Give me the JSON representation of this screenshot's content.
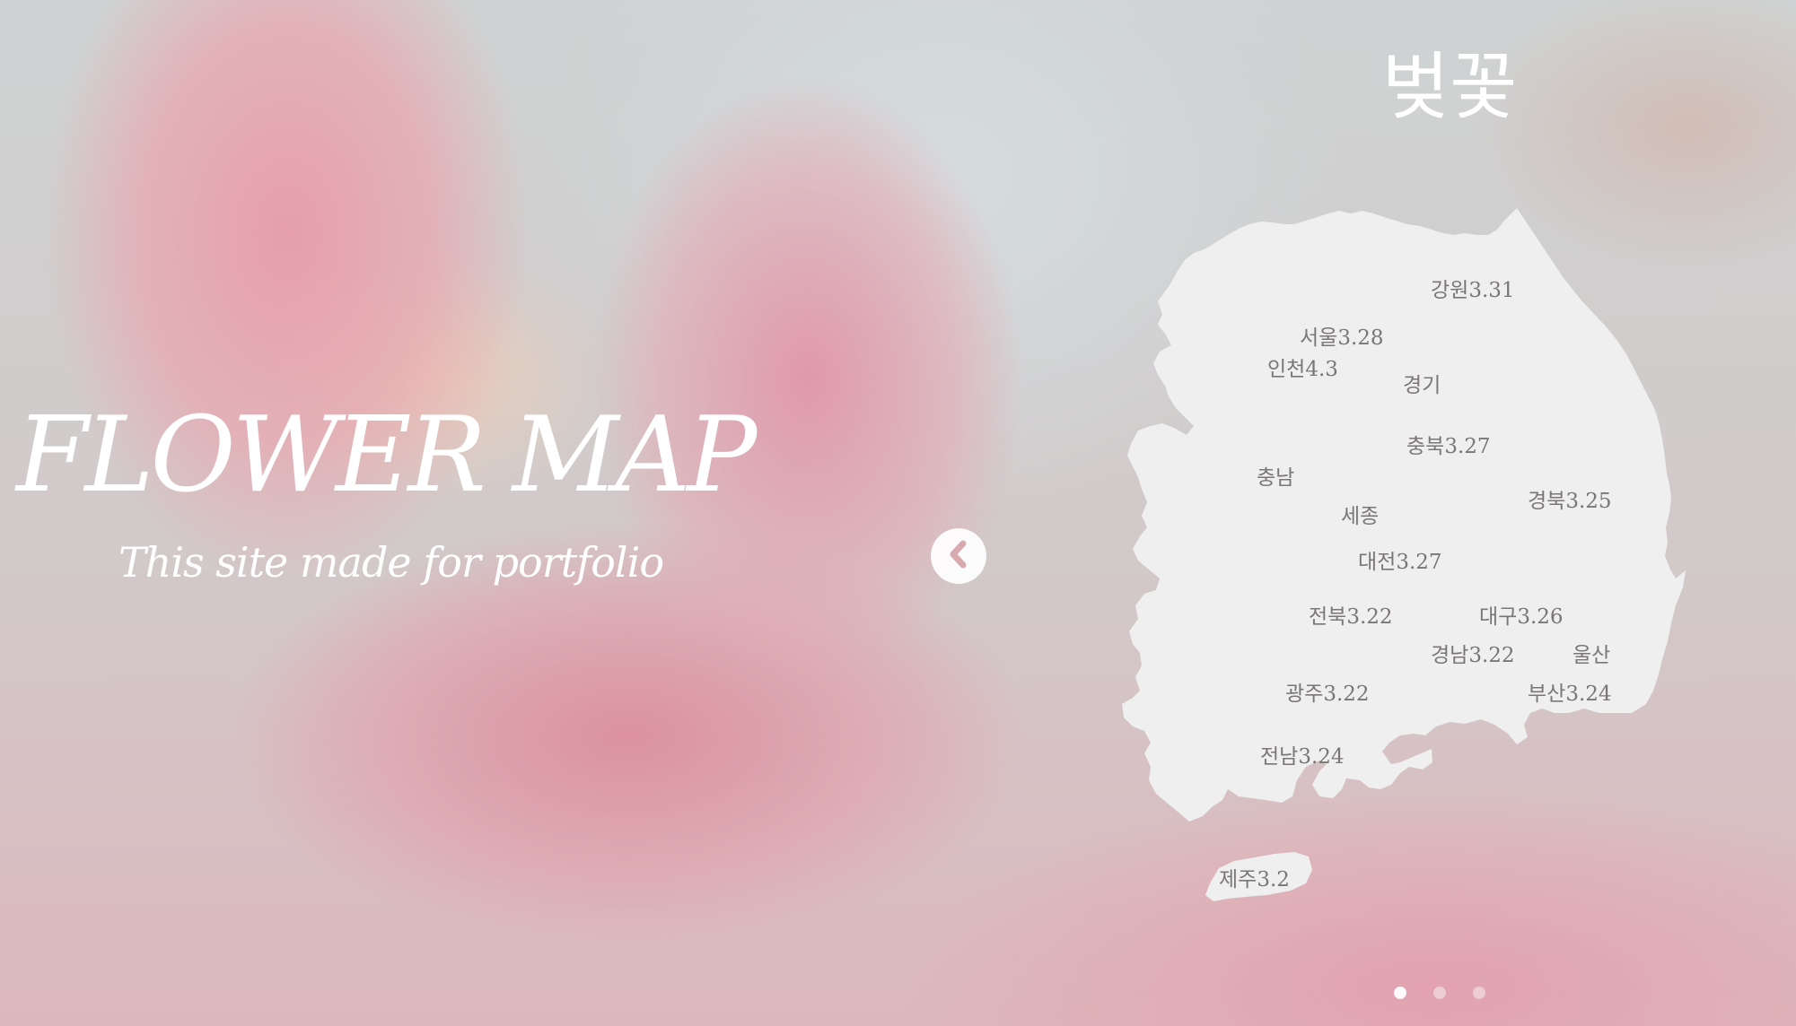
{
  "hero": {
    "title": "FLOWER MAP",
    "subtitle": "This site made for portfolio"
  },
  "flower": {
    "name": "벚꽃"
  },
  "navigation": {
    "prev_icon": "chevron-left-icon"
  },
  "map": {
    "regions": [
      {
        "name": "강원",
        "date": "3.31",
        "label": "강원3.31"
      },
      {
        "name": "서울",
        "date": "3.28",
        "label": "서울3.28"
      },
      {
        "name": "인천",
        "date": "4.3",
        "label": "인천4.3"
      },
      {
        "name": "경기",
        "date": "",
        "label": "경기"
      },
      {
        "name": "충북",
        "date": "3.27",
        "label": "충북3.27"
      },
      {
        "name": "충남",
        "date": "",
        "label": "충남"
      },
      {
        "name": "세종",
        "date": "",
        "label": "세종"
      },
      {
        "name": "경북",
        "date": "3.25",
        "label": "경북3.25"
      },
      {
        "name": "대전",
        "date": "3.27",
        "label": "대전3.27"
      },
      {
        "name": "전북",
        "date": "3.22",
        "label": "전북3.22"
      },
      {
        "name": "대구",
        "date": "3.26",
        "label": "대구3.26"
      },
      {
        "name": "경남",
        "date": "3.22",
        "label": "경남3.22"
      },
      {
        "name": "울산",
        "date": "",
        "label": "울산"
      },
      {
        "name": "광주",
        "date": "3.22",
        "label": "광주3.22"
      },
      {
        "name": "부산",
        "date": "3.24",
        "label": "부산3.24"
      },
      {
        "name": "전남",
        "date": "3.24",
        "label": "전남3.24"
      },
      {
        "name": "제주",
        "date": "3.2",
        "label": "제주3.2"
      }
    ],
    "land_color": "#efefef"
  },
  "pagination": {
    "total": 3,
    "active": 1
  },
  "colors": {
    "text_light": "#ffffff",
    "region_text": "#7a7676"
  }
}
